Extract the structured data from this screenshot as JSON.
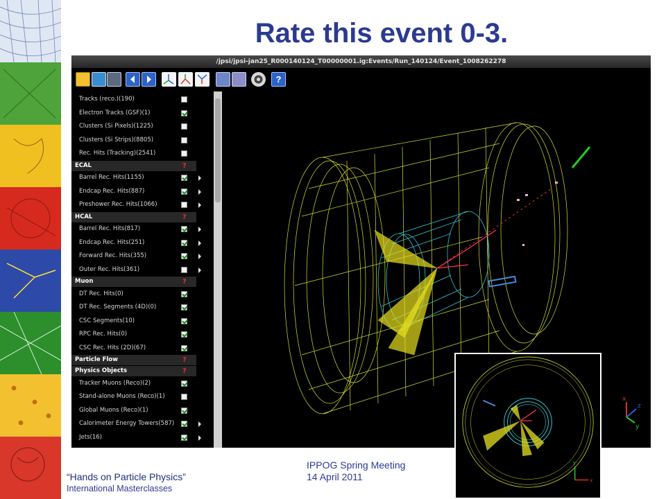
{
  "slide": {
    "title": "Rate this event 0-3.",
    "footer_line1": "IPPOG Spring Meeting",
    "footer_line2": "14 April 2011",
    "logo_line1": "“Hands on Particle Physics”",
    "logo_line2": "International Masterclasses"
  },
  "app": {
    "path": "/jpsi/jpsi-jan25_R000140124_T00000001.ig:Events/Run_140124/Event_1008262278",
    "toolbar_icons": [
      "open-folder-icon",
      "open-url-icon",
      "screenshot-icon",
      "previous-arrow-icon",
      "next-arrow-icon",
      "view-xy-icon",
      "view-yz-icon",
      "view-xz-icon",
      "perspective-cube-icon",
      "ortho-cube-icon",
      "settings-gear-icon",
      "help-icon"
    ]
  },
  "tree": {
    "rows": [
      {
        "kind": "item",
        "label": "Tracks (reco.)(190)",
        "checked": false,
        "expand": false
      },
      {
        "kind": "item",
        "label": "Electron Tracks (GSF)(1)",
        "checked": true,
        "expand": false
      },
      {
        "kind": "item",
        "label": "Clusters (Si Pixels)(1225)",
        "checked": false,
        "expand": false
      },
      {
        "kind": "item",
        "label": "Clusters (Si Strips)(8805)",
        "checked": false,
        "expand": false
      },
      {
        "kind": "item",
        "label": "Rec. Hits (Tracking)(2541)",
        "checked": false,
        "expand": false
      },
      {
        "kind": "cat",
        "label": "ECAL"
      },
      {
        "kind": "item",
        "label": "Barrel Rec. Hits(1155)",
        "checked": true,
        "expand": true
      },
      {
        "kind": "item",
        "label": "Endcap Rec. Hits(887)",
        "checked": true,
        "expand": true
      },
      {
        "kind": "item",
        "label": "Preshower Rec. Hits(1066)",
        "checked": false,
        "expand": true
      },
      {
        "kind": "cat",
        "label": "HCAL"
      },
      {
        "kind": "item",
        "label": "Barrel Rec. Hits(817)",
        "checked": true,
        "expand": true
      },
      {
        "kind": "item",
        "label": "Endcap Rec. Hits(251)",
        "checked": true,
        "expand": true
      },
      {
        "kind": "item",
        "label": "Forward Rec. Hits(355)",
        "checked": true,
        "expand": true
      },
      {
        "kind": "item",
        "label": "Outer Rec. Hits(361)",
        "checked": false,
        "expand": true
      },
      {
        "kind": "cat",
        "label": "Muon"
      },
      {
        "kind": "item",
        "label": "DT Rec. Hits(0)",
        "checked": true,
        "expand": false
      },
      {
        "kind": "item",
        "label": "DT Rec. Segments (4D)(0)",
        "checked": true,
        "expand": false
      },
      {
        "kind": "item",
        "label": "CSC Segments(10)",
        "checked": true,
        "expand": false
      },
      {
        "kind": "item",
        "label": "RPC Rec. Hits(0)",
        "checked": true,
        "expand": false
      },
      {
        "kind": "item",
        "label": "CSC Rec. Hits (2D)(67)",
        "checked": true,
        "expand": false
      },
      {
        "kind": "cat",
        "label": "Particle Flow"
      },
      {
        "kind": "cat",
        "label": "Physics Objects"
      },
      {
        "kind": "item",
        "label": "Tracker Muons (Reco)(2)",
        "checked": true,
        "expand": false
      },
      {
        "kind": "item",
        "label": "Stand-alone Muons (Reco)(1)",
        "checked": false,
        "expand": false
      },
      {
        "kind": "item",
        "label": "Global Muons (Reco)(1)",
        "checked": true,
        "expand": false
      },
      {
        "kind": "item",
        "label": "Calorimeter Energy Towers(587)",
        "checked": true,
        "expand": true
      },
      {
        "kind": "item",
        "label": "Jets(16)",
        "checked": true,
        "expand": true
      }
    ],
    "help_glyph": "?"
  },
  "axes": {
    "x": "x",
    "y": "y",
    "z": "z"
  },
  "colors": {
    "title_blue": "#2b3a91",
    "detector_wire": "#d8e030",
    "tracker_cyan": "#33c8d8",
    "tower_yellow": "#e8e020",
    "track_red": "#ff3355",
    "muon_green": "#22cc22"
  }
}
